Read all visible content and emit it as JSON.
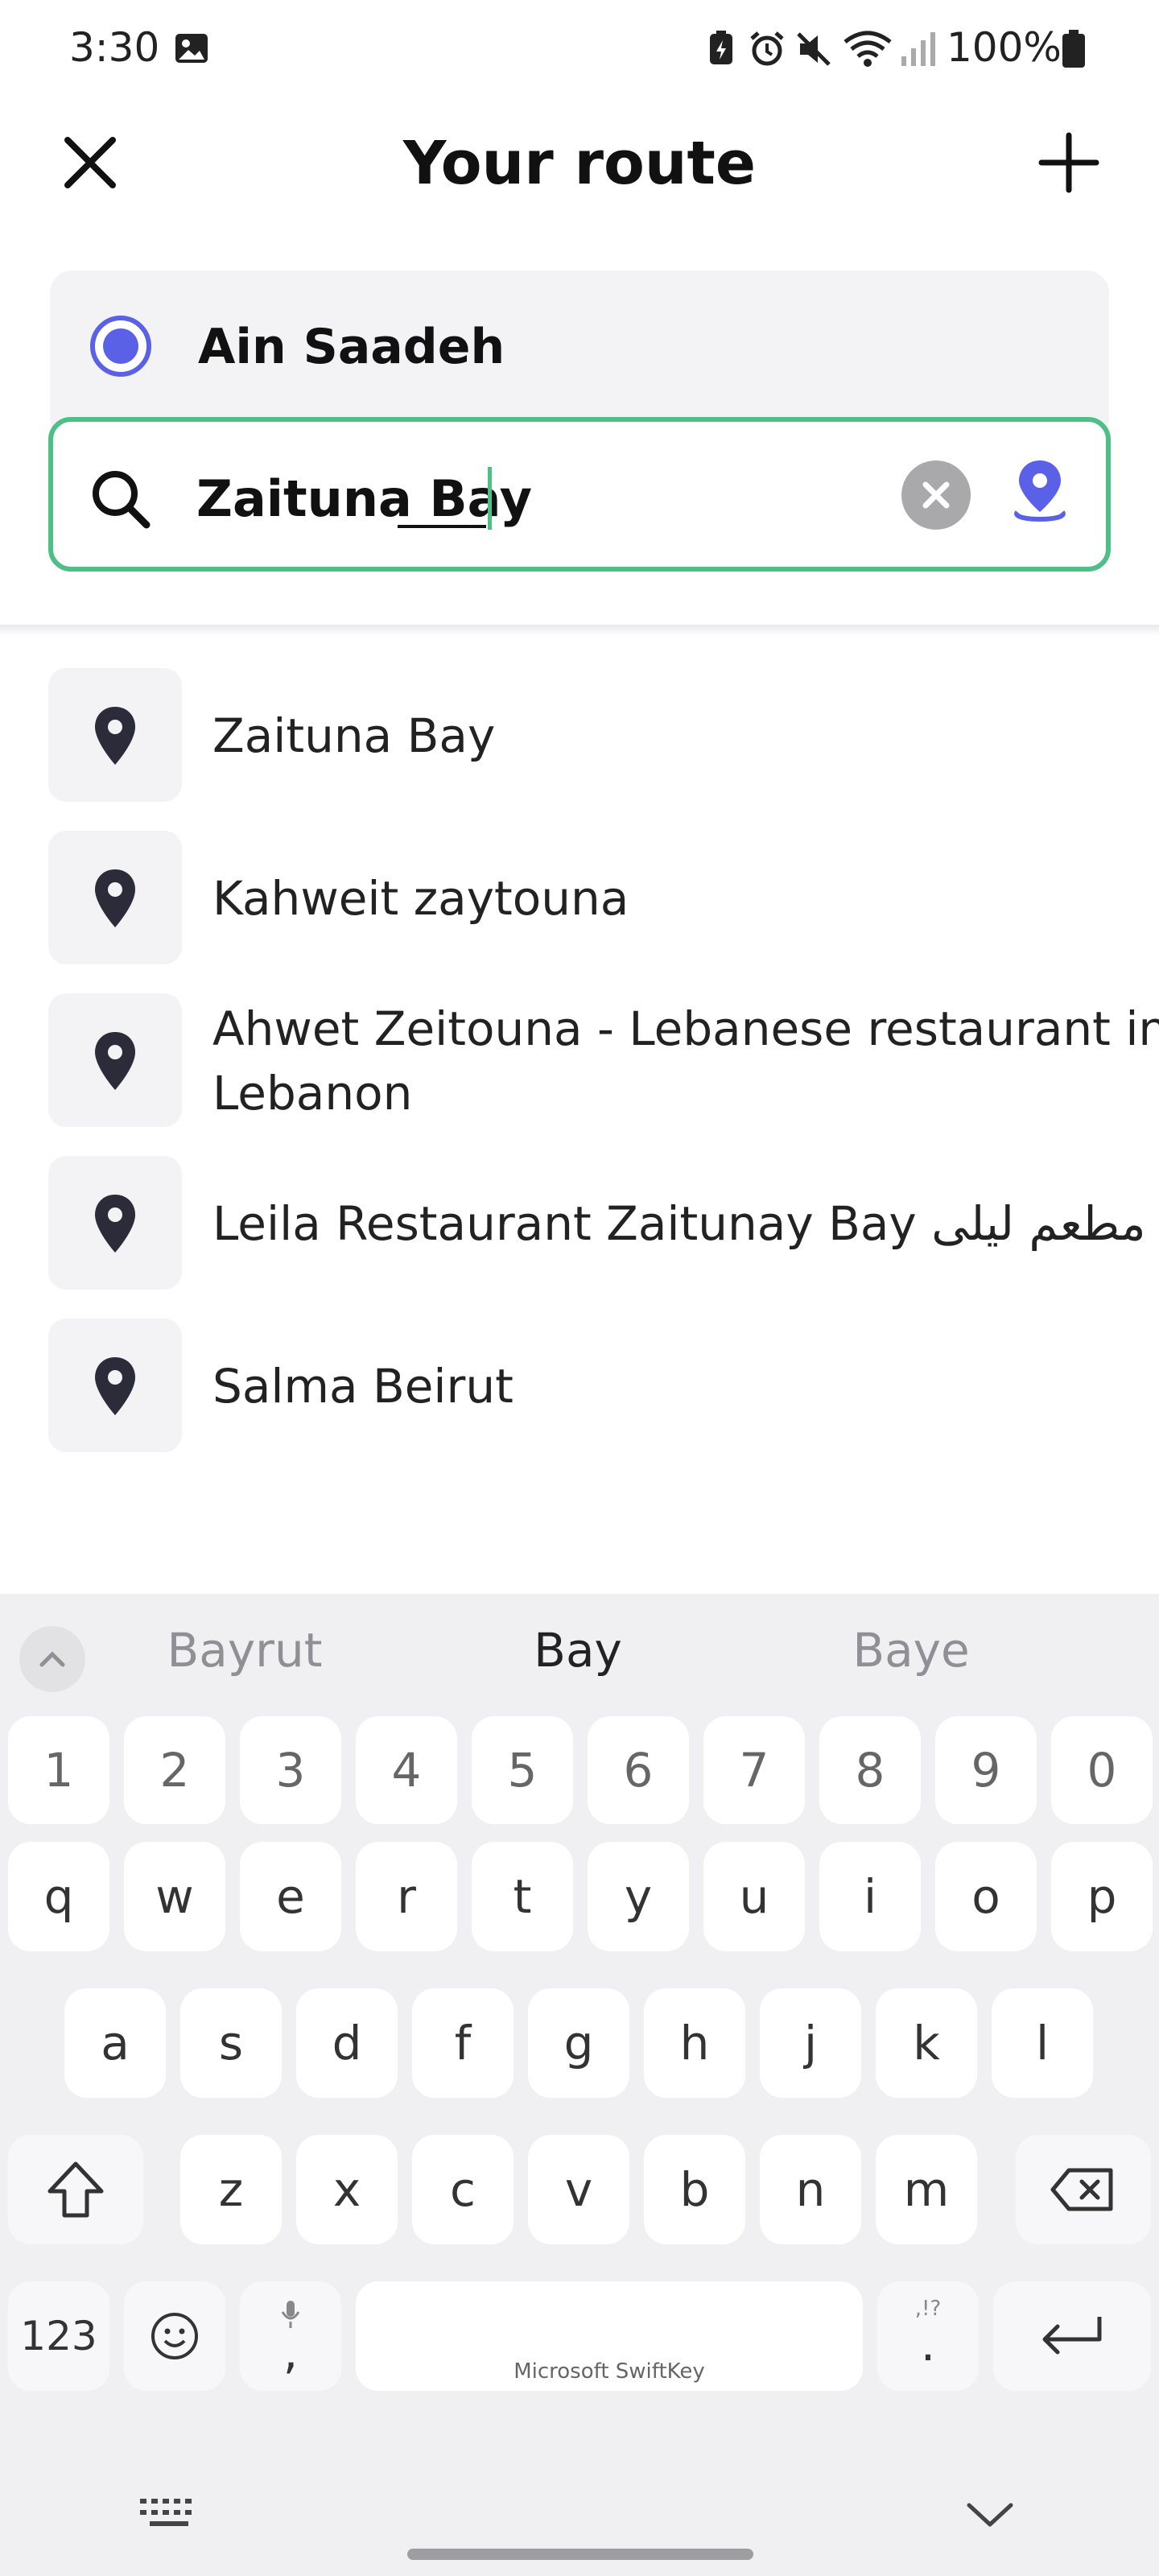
{
  "status_bar": {
    "time": "3:30",
    "battery": "100%"
  },
  "header": {
    "title": "Your route",
    "close_icon": "close-icon",
    "add_icon": "plus-icon"
  },
  "route": {
    "origin": "Ain Saadeh",
    "destination_value": "Zaituna Bay",
    "accent_color": "#5b61e6",
    "focus_color": "#4dbf87"
  },
  "suggestions": [
    {
      "label": "Zaituna Bay"
    },
    {
      "label": "Kahweit zaytouna"
    },
    {
      "label": "Ahwet Zeitouna - Lebanese restaurant in",
      "label2": "Lebanon"
    },
    {
      "label": "Leila Restaurant Zaitunay Bay مطعم ليلى"
    },
    {
      "label": "Salma Beirut"
    }
  ],
  "keyboard": {
    "word_suggestions": [
      "Bayrut",
      "Bay",
      "Baye"
    ],
    "number_row": [
      "1",
      "2",
      "3",
      "4",
      "5",
      "6",
      "7",
      "8",
      "9",
      "0"
    ],
    "row1": [
      "q",
      "w",
      "e",
      "r",
      "t",
      "y",
      "u",
      "i",
      "o",
      "p"
    ],
    "row2": [
      "a",
      "s",
      "d",
      "f",
      "g",
      "h",
      "j",
      "k",
      "l"
    ],
    "row3": [
      "z",
      "x",
      "c",
      "v",
      "b",
      "n",
      "m"
    ],
    "symbols_key": "123",
    "comma_key": ",",
    "space_label": "Microsoft SwiftKey",
    "period_key": ".",
    "period_hint": ",!?"
  }
}
